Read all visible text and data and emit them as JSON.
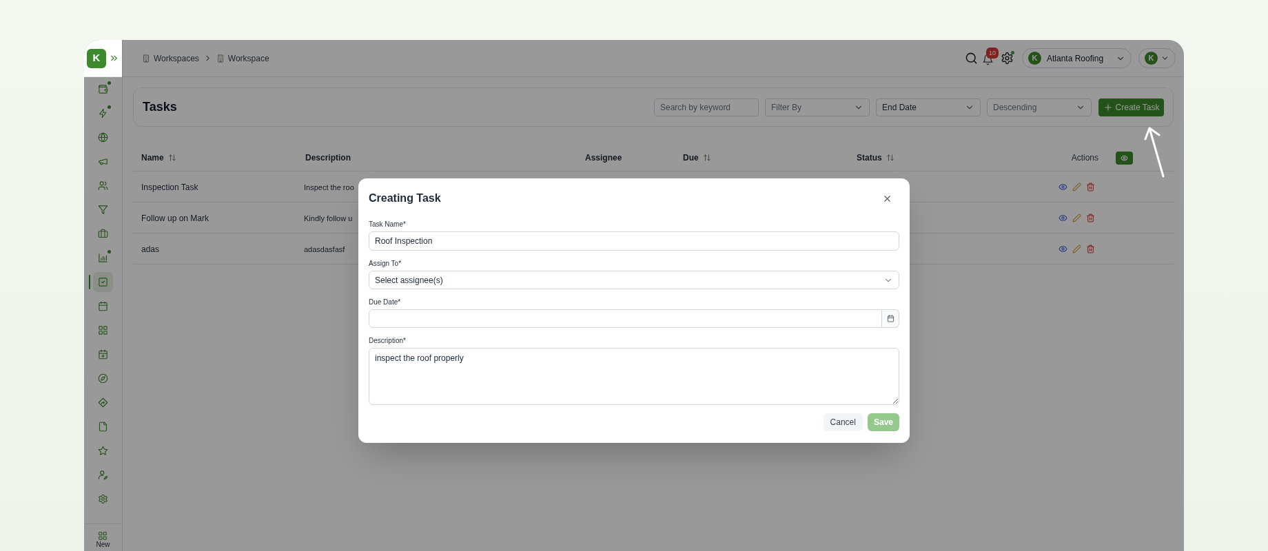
{
  "brand": {
    "letter": "K"
  },
  "sidebar": {
    "items": [
      {
        "selected": false,
        "dot": true
      },
      {
        "selected": false,
        "dot": true
      },
      {
        "selected": false,
        "dot": false
      },
      {
        "selected": false,
        "dot": false
      },
      {
        "selected": false,
        "dot": false
      },
      {
        "selected": false,
        "dot": false
      },
      {
        "selected": false,
        "dot": false
      },
      {
        "selected": false,
        "dot": true
      },
      {
        "selected": true,
        "dot": false
      },
      {
        "selected": false,
        "dot": false
      },
      {
        "selected": false,
        "dot": false
      },
      {
        "selected": false,
        "dot": false
      },
      {
        "selected": false,
        "dot": false
      },
      {
        "selected": false,
        "dot": false
      },
      {
        "selected": false,
        "dot": false
      },
      {
        "selected": false,
        "dot": false
      },
      {
        "selected": false,
        "dot": false
      },
      {
        "selected": false,
        "dot": false
      }
    ],
    "new_label": "New"
  },
  "breadcrumb": [
    "Workspaces",
    "Workspace"
  ],
  "header": {
    "notifications": "10",
    "settings_dot": true,
    "company": {
      "logo_letter": "K",
      "name": "Atlanta Roofing"
    },
    "user": {
      "avatar_letter": "K"
    }
  },
  "page": {
    "title": "Tasks",
    "search": {
      "placeholder": "Search by keyword"
    },
    "filters": [
      {
        "label": "Filter By",
        "is_placeholder": true
      },
      {
        "label": "End Date",
        "is_placeholder": false
      },
      {
        "label": "Descending",
        "is_placeholder": true
      }
    ],
    "create_button": "Create Task"
  },
  "table": {
    "columns": [
      {
        "label": "Name",
        "sortable": true
      },
      {
        "label": "Description",
        "sortable": false
      },
      {
        "label": "Assignee",
        "sortable": false
      },
      {
        "label": "Due",
        "sortable": true
      },
      {
        "label": "Status",
        "sortable": true
      },
      {
        "label": "Actions",
        "sortable": false
      }
    ],
    "rows": [
      {
        "name": "Inspection Task",
        "description": "Inspect the roo"
      },
      {
        "name": "Follow up on Mark",
        "description": "Kindly follow u"
      },
      {
        "name": "adas",
        "description": "adasdasfasf"
      }
    ]
  },
  "modal": {
    "title": "Creating Task",
    "fields": [
      {
        "kind": "text",
        "label": "Task Name*",
        "value": "Roof Inspection"
      },
      {
        "kind": "select",
        "label": "Assign To*",
        "placeholder": "Select assignee(s)"
      },
      {
        "kind": "date",
        "label": "Due Date*"
      },
      {
        "kind": "textarea",
        "label": "Description*",
        "value": "inspect the roof properly"
      }
    ],
    "cancel": "Cancel",
    "save": {
      "label": "Save",
      "disabled": true
    }
  }
}
